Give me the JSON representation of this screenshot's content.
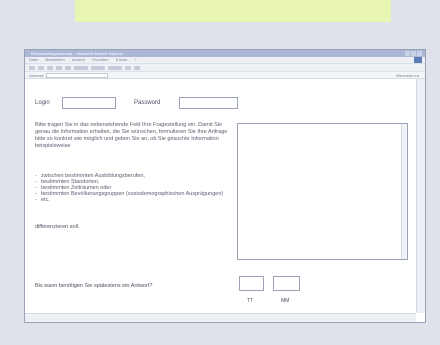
{
  "window": {
    "title": "Rückmeldungsformular – Microsoft Internet Explorer",
    "menus": [
      "Datei",
      "Bearbeiten",
      "Ansicht",
      "Favoriten",
      "Extras",
      "?"
    ],
    "address_label": "Adresse",
    "go_label": "Wechseln zu"
  },
  "form": {
    "login_label": "Login",
    "password_label": "Password",
    "intro": "Bitte tragen Sie in das nebenstehende Feld Ihre Fragestellung ein. Damit Sie genau die Information erhalten, die Sie wünschen, formulieren Sie Ihre Anfrage bitte so konkret wie möglich und geben Sie an, ob Sie gesuchte Information beispielsweise",
    "bullets": [
      "zwischen bestimmten Ausbildungsberufen,",
      "bestimmten Standorten,",
      "bestimmten Zeiträumen oder",
      "bestimmten Bevölkerungsgruppen (soziodemographischen Ausprägungen)",
      "etc."
    ],
    "outro": "differenzieren soll.",
    "deadline_question": "Bis wann benötigen Sie spätestens ein Antwort?",
    "day_label": "TT",
    "month_label": "MM"
  }
}
